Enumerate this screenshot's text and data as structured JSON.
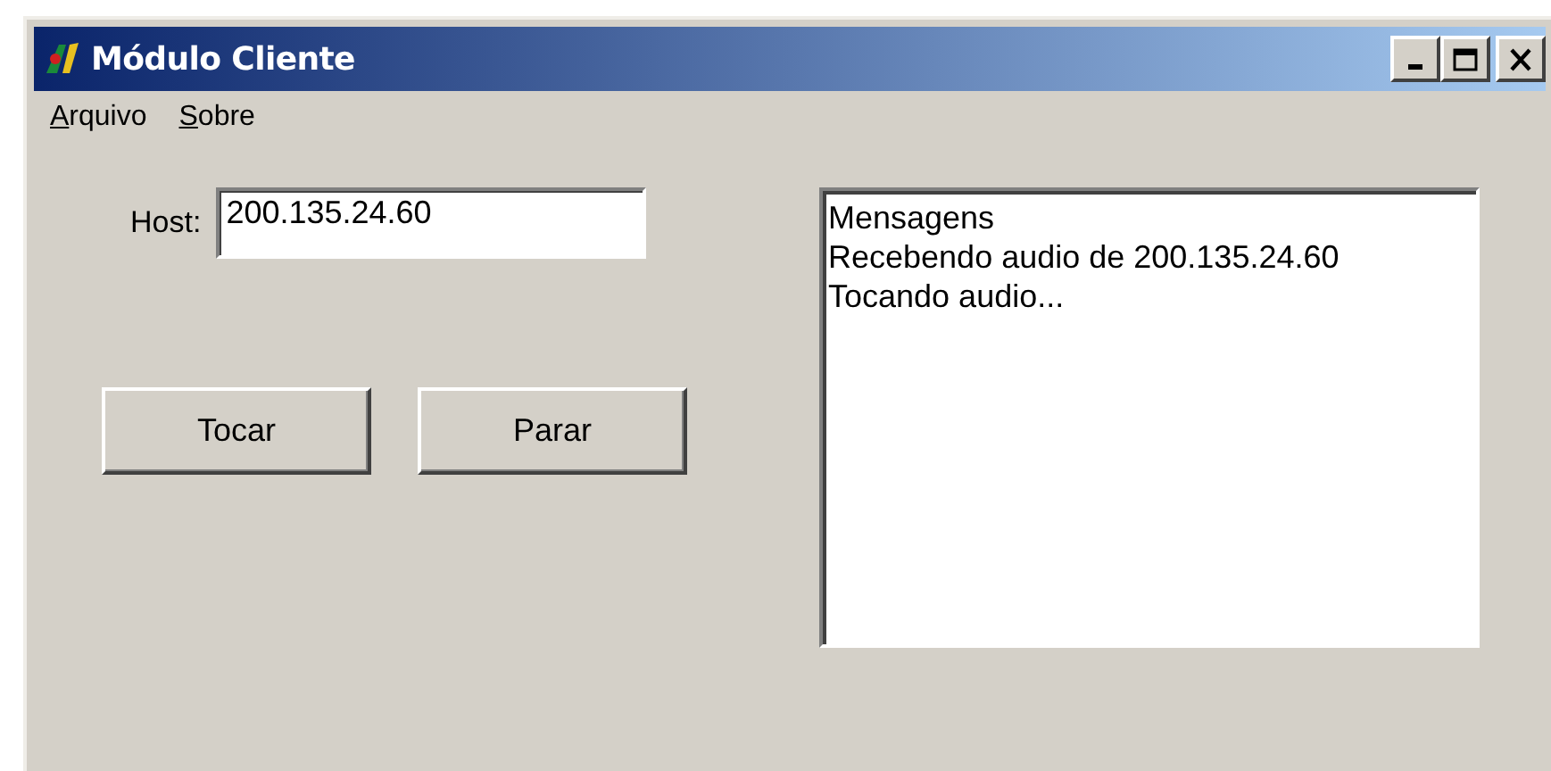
{
  "window": {
    "title": "Módulo Cliente"
  },
  "menu": [
    {
      "access_key": "A",
      "rest": "rquivo"
    },
    {
      "access_key": "S",
      "rest": "obre"
    }
  ],
  "host": {
    "label": "Host:",
    "value": "200.135.24.60"
  },
  "buttons": [
    "Tocar",
    "Parar"
  ],
  "messages": [
    "Mensagens",
    "Recebendo audio de 200.135.24.60",
    "Tocando audio..."
  ]
}
